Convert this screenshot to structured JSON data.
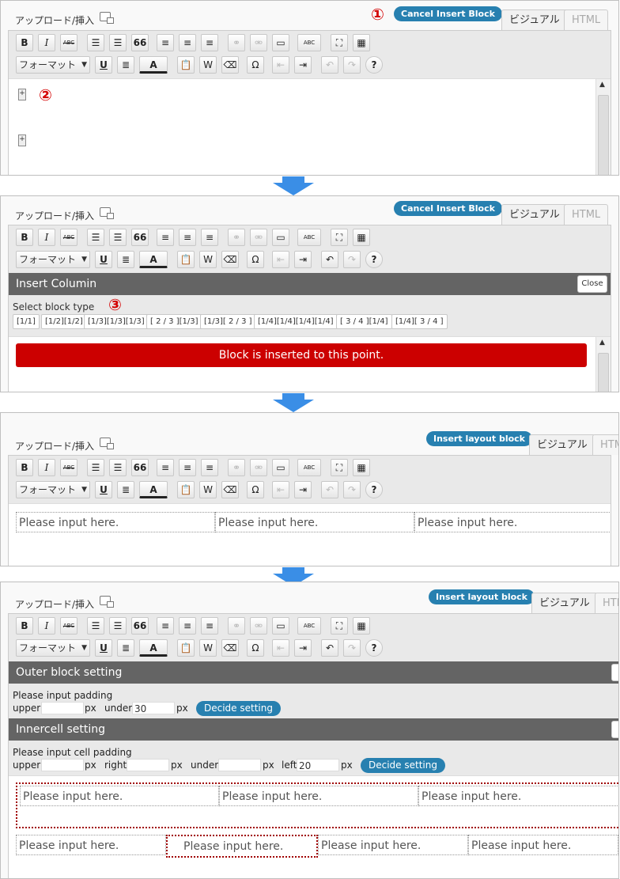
{
  "common": {
    "media_label": "アップロード/挿入",
    "tab_visual": "ビジュアル",
    "tab_html": "HTML",
    "format_label": "フォーマット",
    "tb_bold": "B",
    "tb_italic": "I",
    "tb_strike": "ABC",
    "tb_quote": "66",
    "tb_underline": "U",
    "tb_color": "A",
    "tb_omega": "Ω",
    "tb_help": "?",
    "tb_spell": "ABC"
  },
  "panel1": {
    "cancel_btn": "Cancel Insert Block",
    "callout_1": "①",
    "callout_2": "②",
    "plus": "+"
  },
  "panel2": {
    "cancel_btn": "Cancel Insert Block",
    "bar_title": "Insert Columin",
    "close": "Close",
    "select_label": "Select block type",
    "callout_3": "③",
    "block_types": [
      "[1/1]",
      "[1/2][1/2]",
      "[1/3][1/3][1/3]",
      "[ 2 / 3 ][1/3]",
      "[1/3][ 2 / 3 ]",
      "[1/4][1/4][1/4][1/4]",
      "[ 3 / 4 ][1/4]",
      "[1/4][ 3 / 4 ]"
    ],
    "insert_point": "Block is inserted to this point."
  },
  "panel3": {
    "insert_btn": "Insert layout block",
    "cells": [
      "Please input here.",
      "Please input here.",
      "Please input here."
    ]
  },
  "panel4": {
    "insert_btn": "Insert layout block",
    "outer_title": "Outer block setting",
    "outer_close": "C",
    "outer_label": "Please input padding",
    "upper": "upper",
    "under": "under",
    "px": "px",
    "outer_under_value": "30",
    "decide": "Decide setting",
    "inner_title": "Innercell setting",
    "inner_close": "C",
    "inner_label": "Please input cell padding",
    "right": "right",
    "left": "left",
    "inner_left_value": "20",
    "row1": [
      "Please input here.",
      "Please input here.",
      "Please input here."
    ],
    "row2": [
      "Please input here.",
      "Please input here.",
      "Please input here.",
      "Please input here."
    ]
  },
  "colors": {
    "accent": "#2780b0",
    "alert": "#cc0000",
    "bar": "#646464",
    "callout": "#d40000"
  }
}
